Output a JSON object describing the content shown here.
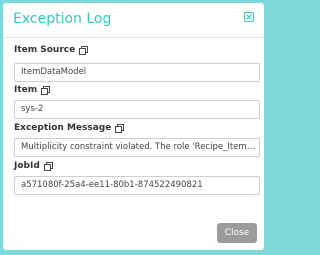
{
  "dialog": {
    "title": "Exception Log",
    "close_button": "Close"
  },
  "fields": [
    {
      "label": "Item Source",
      "value": "ItemDataModel"
    },
    {
      "label": "Item",
      "value": "sys-2"
    },
    {
      "label": "Exception Message",
      "value": "Multiplicity constraint violated. The role 'Recipe_Item_..."
    },
    {
      "label": "JobId",
      "value": "a571080f-25a4-ee11-80b1-874522490821"
    }
  ],
  "icons": {
    "close": "close-icon",
    "copy": "copy-icon"
  },
  "colors": {
    "accent": "#3cc4c5",
    "backdrop": "#7fd9da",
    "button": "#9b9b9b"
  }
}
